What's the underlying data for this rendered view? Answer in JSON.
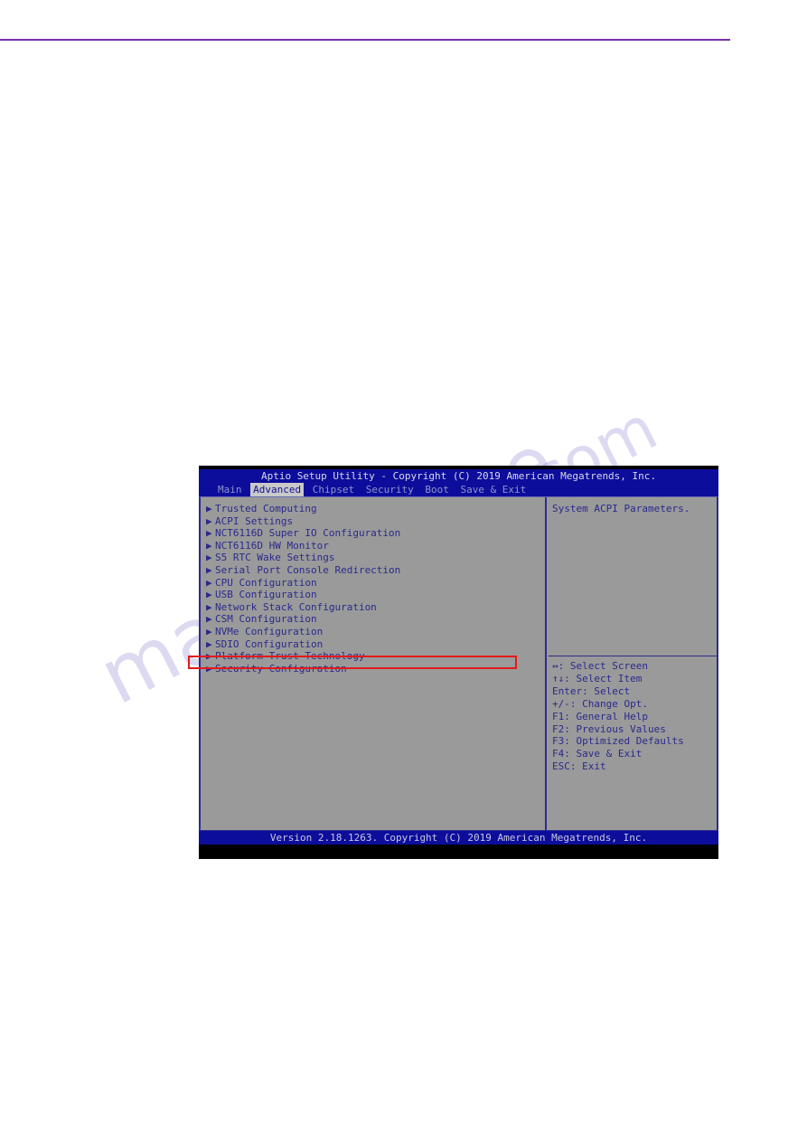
{
  "page": {
    "rule_color": "#7b2fa8"
  },
  "watermark": {
    "line1": "manualshive",
    "line2": ".com"
  },
  "bios": {
    "title": "Aptio Setup Utility - Copyright (C) 2019 American Megatrends, Inc.",
    "tabs": [
      {
        "label": "Main",
        "active": false
      },
      {
        "label": "Advanced",
        "active": true
      },
      {
        "label": "Chipset",
        "active": false
      },
      {
        "label": "Security",
        "active": false
      },
      {
        "label": "Boot",
        "active": false
      },
      {
        "label": "Save & Exit",
        "active": false
      }
    ],
    "bullet": "▶",
    "menu_items": [
      {
        "label": "Trusted Computing"
      },
      {
        "label": "ACPI Settings"
      },
      {
        "label": "NCT6116D Super IO Configuration"
      },
      {
        "label": "NCT6116D HW Monitor"
      },
      {
        "label": "S5 RTC Wake Settings"
      },
      {
        "label": "Serial Port Console Redirection"
      },
      {
        "label": "CPU Configuration"
      },
      {
        "label": "USB Configuration"
      },
      {
        "label": "Network Stack Configuration"
      },
      {
        "label": "CSM Configuration"
      },
      {
        "label": "NVMe Configuration"
      },
      {
        "label": "SDIO Configuration"
      },
      {
        "label": "Platform Trust Technology"
      },
      {
        "label": "Security Configuration"
      }
    ],
    "help_text": "System ACPI Parameters.",
    "keys": [
      {
        "label": "↔: Select Screen"
      },
      {
        "label": "↑↓: Select Item"
      },
      {
        "label": "Enter: Select"
      },
      {
        "label": "+/-: Change Opt."
      },
      {
        "label": "F1: General Help"
      },
      {
        "label": "F2: Previous Values"
      },
      {
        "label": "F3: Optimized Defaults"
      },
      {
        "label": "F4: Save & Exit"
      },
      {
        "label": "ESC: Exit"
      }
    ],
    "footer": "Version 2.18.1263. Copyright (C) 2019 American Megatrends, Inc.",
    "highlight": {
      "target": "Platform Trust Technology",
      "color": "#e01b1b"
    }
  }
}
